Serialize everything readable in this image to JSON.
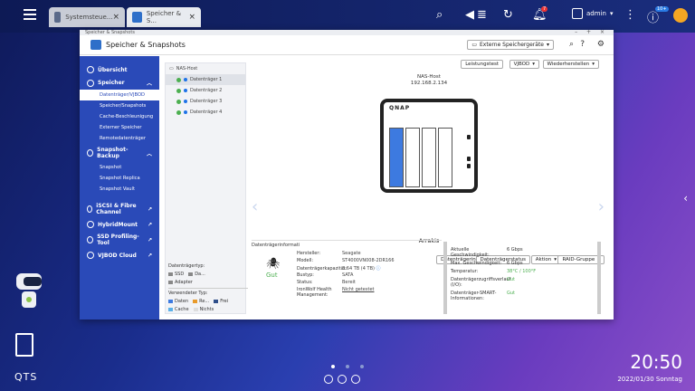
{
  "topbar": {
    "tabs": [
      {
        "label": "Systemsteue..."
      },
      {
        "label": "Speicher & S..."
      }
    ],
    "notification_count": "7",
    "user": "admin",
    "info_badge": "10+"
  },
  "window": {
    "caption": "Speicher & Snapshots",
    "app_title": "Speicher & Snapshots",
    "external_devices": "Externe Speichergeräte"
  },
  "sidebar": {
    "overview": "Übersicht",
    "storage": "Speicher",
    "storage_items": [
      "Datenträger/VJBOD",
      "Speicher/Snapshots",
      "Cache-Beschleunigung",
      "Externer Speicher",
      "Remotedatenträger"
    ],
    "snapshot_backup": "Snapshot-Backup",
    "snapshot_items": [
      "Snapshot",
      "Snapshot Replica",
      "Snapshot Vault"
    ],
    "iscsi": "iSCSI & Fibre Channel",
    "hybridmount": "HybridMount",
    "ssd": "SSD Profiling-Tool",
    "vjbod": "VJBOD Cloud"
  },
  "tree": {
    "host": "NAS-Host",
    "disks": [
      "Datenträger 1",
      "Datenträger 2",
      "Datenträger 3",
      "Datenträger 4"
    ]
  },
  "legend": {
    "type_label": "Datenträgertyp:",
    "ssd": "SSD",
    "da": "Da...",
    "adapter": "Adapter",
    "used_label": "Verwendeter Typ:",
    "daten": "Daten",
    "re": "Re...",
    "frei": "Frei",
    "cache": "Cache",
    "nichts": "Nichts"
  },
  "main": {
    "btn_perf": "Leistungstest",
    "btn_vjbod": "VJBOD",
    "btn_restore": "Wiederherstellen",
    "host_name": "NAS-Host",
    "host_ip": "192.168.2.134",
    "nas_name": "Arrakis",
    "btn_diskinfo": "Datenträgerinfo",
    "btn_diskstatus": "Datenträgerstatus",
    "btn_action": "Aktion",
    "btn_raid": "RAID-Gruppe"
  },
  "info": {
    "header": "Datenträgerinformati",
    "health": "Gut",
    "rows": [
      {
        "k": "Hersteller:",
        "v": "Seagate"
      },
      {
        "k": "Modell:",
        "v": "ST4000VN008-2DR166"
      },
      {
        "k": "Datenträgerkapazität:",
        "v": "3.64 TB (4 TB)"
      },
      {
        "k": "Bustyp:",
        "v": "SATA"
      },
      {
        "k": "Status:",
        "v": "Bereit"
      },
      {
        "k": "IronWolf Health Management:",
        "v": "Nicht getestet"
      }
    ]
  },
  "stats": [
    {
      "k": "Aktuelle Geschwindigkeit:",
      "v": "6 Gbps"
    },
    {
      "k": "Max. Geschwindigkeit:",
      "v": "6 Gbps"
    },
    {
      "k": "Temperatur:",
      "v": "38°C / 100°F"
    },
    {
      "k": "Datenträgerzugriffsverlauf (I/O):",
      "v": "Gut"
    },
    {
      "k": "Datenträger-SMART-Informationen:",
      "v": "Gut"
    }
  ],
  "desktop": {
    "qts": "QTS",
    "time": "20:50",
    "date": "2022/01/30 Sonntag"
  }
}
